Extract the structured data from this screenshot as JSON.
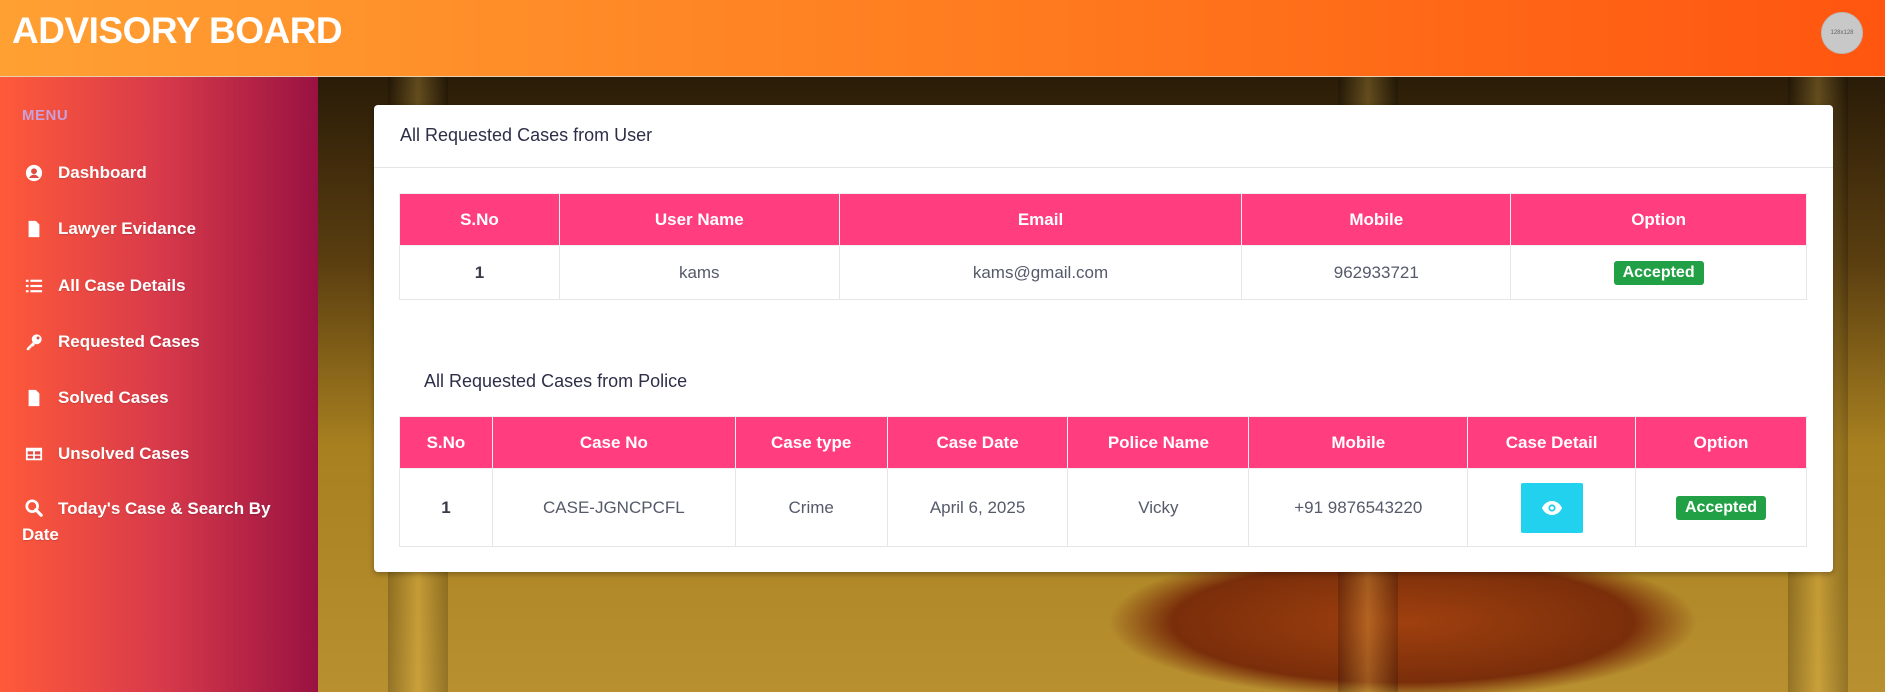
{
  "header": {
    "brand": "ADVISORY BOARD",
    "avatar_text": "128x128"
  },
  "sidebar": {
    "menu_title": "MENU",
    "items": [
      {
        "label": "Dashboard",
        "icon": "user-circle-icon"
      },
      {
        "label": "Lawyer Evidance",
        "icon": "file-icon"
      },
      {
        "label": "All Case Details",
        "icon": "list-icon"
      },
      {
        "label": "Requested Cases",
        "icon": "key-icon"
      },
      {
        "label": "Solved Cases",
        "icon": "file-icon"
      },
      {
        "label": "Unsolved Cases",
        "icon": "table-icon"
      },
      {
        "label": "Today's Case & Search By Date",
        "icon": "search-icon"
      }
    ]
  },
  "user_cases": {
    "title": "All Requested Cases from User",
    "columns": [
      "S.No",
      "User Name",
      "Email",
      "Mobile",
      "Option"
    ],
    "rows": [
      {
        "sno": "1",
        "user_name": "kams",
        "email": "kams@gmail.com",
        "mobile": "962933721",
        "option": "Accepted"
      }
    ]
  },
  "police_cases": {
    "title": "All Requested Cases from Police",
    "columns": [
      "S.No",
      "Case No",
      "Case type",
      "Case Date",
      "Police Name",
      "Mobile",
      "Case Detail",
      "Option"
    ],
    "rows": [
      {
        "sno": "1",
        "case_no": "CASE-JGNCPCFL",
        "case_type": "Crime",
        "case_date": "April 6, 2025",
        "police_name": "Vicky",
        "mobile": "+91 9876543220",
        "case_detail_icon": "eye-icon",
        "option": "Accepted"
      }
    ]
  },
  "colors": {
    "header_gradient": [
      "#ffa033",
      "#ff5510"
    ],
    "table_header": "#ff3d7f",
    "accepted_badge": "#22a045",
    "view_button": "#22d1ee"
  }
}
